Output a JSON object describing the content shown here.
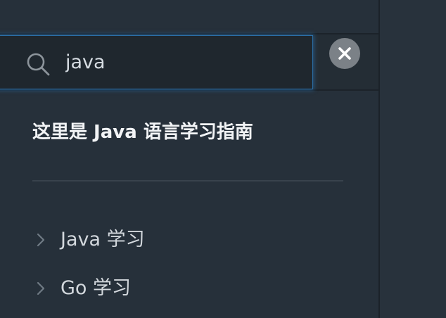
{
  "search": {
    "value": "java",
    "placeholder": ""
  },
  "guide": {
    "title": "这里是 Java 语言学习指南"
  },
  "list": {
    "items": [
      {
        "label": "Java 学习"
      },
      {
        "label": "Go 学习"
      }
    ]
  },
  "icons": {
    "search": "search-icon",
    "clear": "close-icon",
    "chevron": "chevron-right-icon"
  },
  "colors": {
    "background": "#26303a",
    "focus_ring": "#2b6fa8",
    "text_primary": "#f2f4f6",
    "text_secondary": "#d3d8dd"
  }
}
